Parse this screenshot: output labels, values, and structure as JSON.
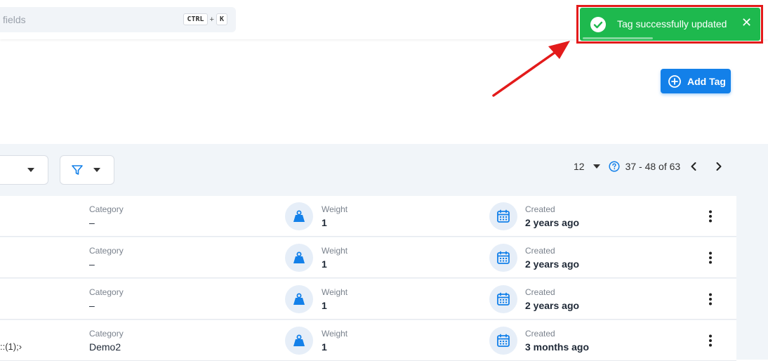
{
  "search": {
    "placeholder_fragment": "fields",
    "shortcut_key1": "CTRL",
    "shortcut_plus": "+",
    "shortcut_key2": "K"
  },
  "toast": {
    "message": "Tag successfully updated",
    "close": "✕",
    "color": "#1eb94e",
    "highlight_color": "#e31b1b"
  },
  "add_tag_button": {
    "label": "Add Tag",
    "color": "#1380e9"
  },
  "pagination": {
    "page_size": "12",
    "range": "37 - 48 of 63"
  },
  "rows": [
    {
      "name_fragment": "",
      "category_label": "Category",
      "category_value": "–",
      "weight_label": "Weight",
      "weight_value": "1",
      "created_label": "Created",
      "created_value": "2 years ago"
    },
    {
      "name_fragment": "",
      "category_label": "Category",
      "category_value": "–",
      "weight_label": "Weight",
      "weight_value": "1",
      "created_label": "Created",
      "created_value": "2 years ago"
    },
    {
      "name_fragment": "",
      "category_label": "Category",
      "category_value": "–",
      "weight_label": "Weight",
      "weight_value": "1",
      "created_label": "Created",
      "created_value": "2 years ago"
    },
    {
      "name_fragment": "::(1);›",
      "category_label": "Category",
      "category_value": "Demo2",
      "weight_label": "Weight",
      "weight_value": "1",
      "created_label": "Created",
      "created_value": "3 months ago"
    }
  ]
}
